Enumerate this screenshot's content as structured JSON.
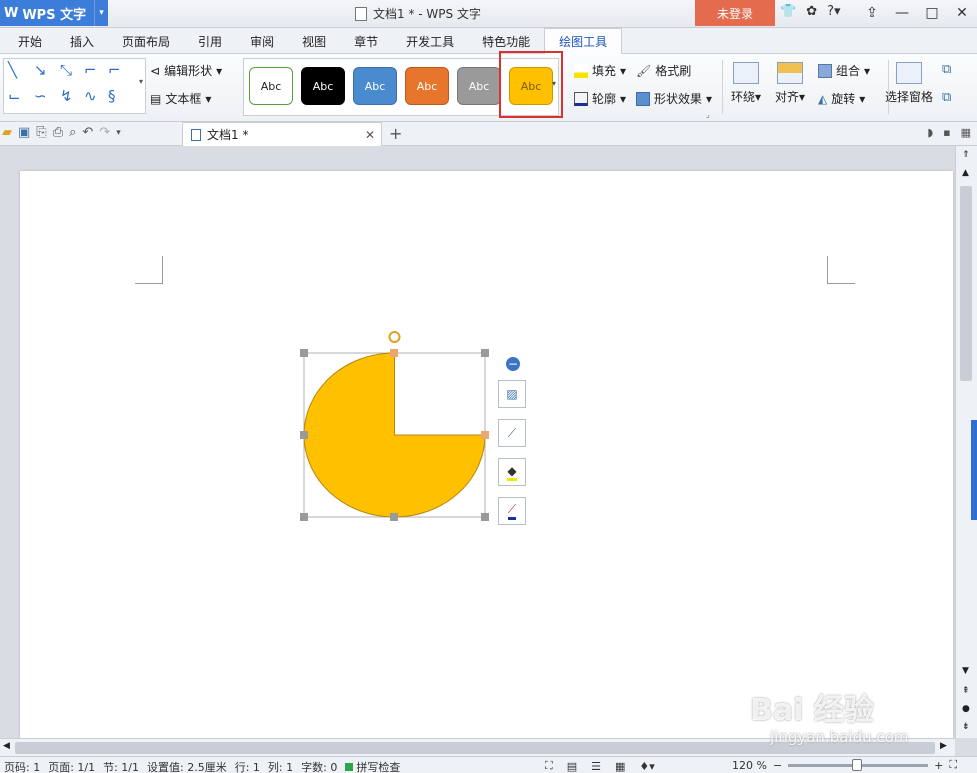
{
  "titlebar": {
    "app_name": "WPS 文字",
    "window_title": "文档1 * - WPS 文字",
    "login_label": "未登录"
  },
  "ribbon_tabs": [
    {
      "label": "开始"
    },
    {
      "label": "插入"
    },
    {
      "label": "页面布局"
    },
    {
      "label": "引用"
    },
    {
      "label": "审阅"
    },
    {
      "label": "视图"
    },
    {
      "label": "章节"
    },
    {
      "label": "开发工具"
    },
    {
      "label": "特色功能"
    },
    {
      "label": "绘图工具",
      "active": true
    }
  ],
  "ribbon": {
    "edit_shape_label": "编辑形状",
    "textbox_label": "文本框",
    "styles": [
      {
        "label": "Abc",
        "bg": "#ffffff",
        "fg": "#222222",
        "border": "#5a9e3a"
      },
      {
        "label": "Abc",
        "bg": "#000000",
        "fg": "#ffffff",
        "border": "#000000"
      },
      {
        "label": "Abc",
        "bg": "#4a8bd0",
        "fg": "#ffffff",
        "border": "#3a6faa"
      },
      {
        "label": "Abc",
        "bg": "#e8752c",
        "fg": "#ffffff",
        "border": "#b95a1f"
      },
      {
        "label": "Abc",
        "bg": "#9a9a9a",
        "fg": "#ffffff",
        "border": "#777777"
      },
      {
        "label": "Abc",
        "bg": "#ffc000",
        "fg": "#7a5a00",
        "border": "#c99a00",
        "selected": true
      }
    ],
    "fill_label": "填充",
    "outline_label": "轮廓",
    "format_painter_label": "格式刷",
    "shape_effects_label": "形状效果",
    "wrap_label": "环绕",
    "align_label": "对齐",
    "group_label": "组合",
    "rotate_label": "旋转",
    "selection_pane_label": "选择窗格"
  },
  "doc_tab": {
    "label": "文档1 *"
  },
  "shape": {
    "fill": "#ffc000",
    "stroke": "#b8860b"
  },
  "watermark": {
    "line1": "Bai 经验",
    "line2": "jingyan.baidu.com"
  },
  "statusbar": {
    "page_no": "页码: 1",
    "pages": "页面: 1/1",
    "section": "节: 1/1",
    "setting": "设置值: 2.5厘米",
    "row": "行: 1",
    "col": "列: 1",
    "words": "字数: 0",
    "spell": "拼写检查",
    "zoom": "120 %"
  }
}
